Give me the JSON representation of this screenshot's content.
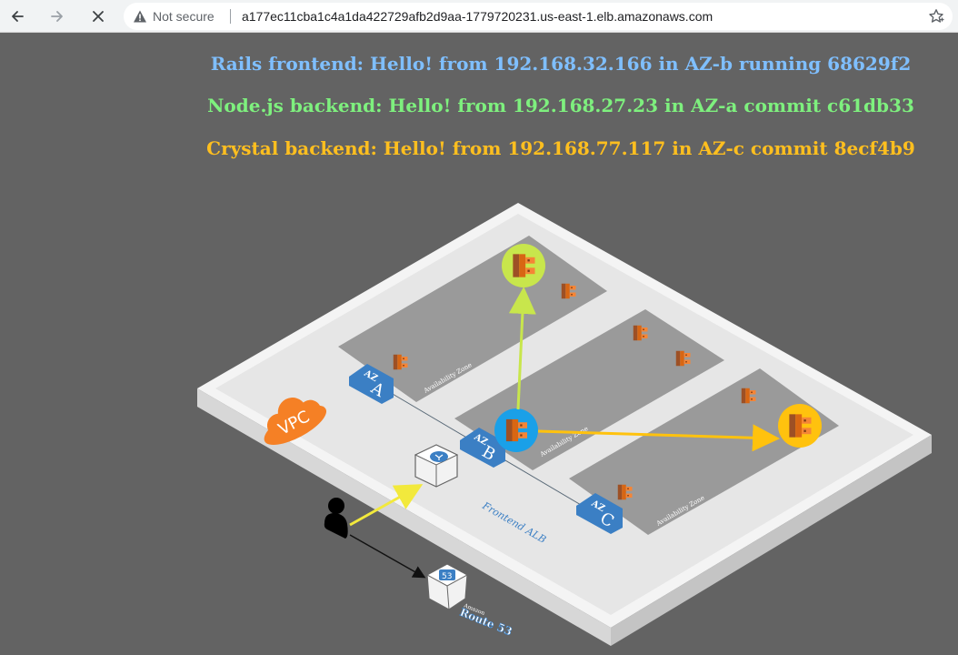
{
  "browser": {
    "security_label": "Not secure",
    "url": "a177ec11cba1c4a1da422729afb2d9aa-1779720231.us-east-1.elb.amazonaws.com"
  },
  "status": {
    "rails": {
      "text": "Rails frontend: Hello! from 192.168.32.166 in AZ-b running 68629f2",
      "color": "#7fbfff"
    },
    "node": {
      "text": "Node.js backend: Hello! from 192.168.27.23 in AZ-a commit c61db33",
      "color": "#7ef07e"
    },
    "crystal": {
      "text": "Crystal backend: Hello! from 192.168.77.117 in AZ-c commit 8ecf4b9",
      "color": "#ffbf1f"
    }
  },
  "diagram": {
    "vpc_label": "VPC",
    "az_labels": [
      {
        "prefix": "AZ",
        "letter": "A"
      },
      {
        "prefix": "AZ",
        "letter": "B"
      },
      {
        "prefix": "AZ",
        "letter": "C"
      }
    ],
    "zone_caption": "Availability Zone",
    "frontend_alb_label": "Frontend ALB",
    "route53_label": "Route 53",
    "route53_sublabel": "Amazon",
    "route53_icon_text": "53",
    "colors": {
      "az_blue": "#3b7fc4",
      "vpc_orange": "#f58025",
      "arrow_green": "#c8e64c",
      "arrow_gold": "#ffc20e",
      "arrow_yellow": "#f2e93c",
      "ecs_orange": "#d86613",
      "alb_blue": "#1aa0e8"
    },
    "icons": [
      "user-icon",
      "router-icon",
      "route53-icon",
      "ecs-icon",
      "alb-icon",
      "vpc-cloud-icon"
    ]
  }
}
